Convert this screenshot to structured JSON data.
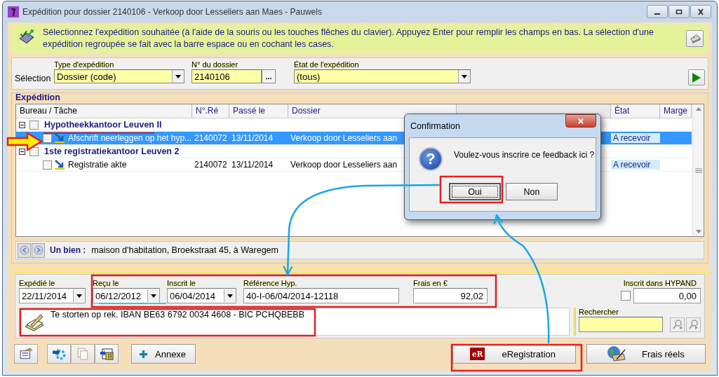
{
  "window": {
    "title": "Expédition pour dossier 2140106 - Verkoop door Lesseliers aan Maes - Pauwels"
  },
  "info": {
    "text": "Sélectionnez l'expédition souhaitée (à l'aide de la souris ou les touches flêches du clavier). Appuyez Enter pour remplir les champs en bas. La sélection d'une expédition regroupée se fait avec la barre espace ou en cochant les cases."
  },
  "selection": {
    "label": "Sélection",
    "fields": [
      {
        "kind": "dropdown",
        "label": "Type d'expédition",
        "value": "Dossier (code)"
      },
      {
        "kind": "browse",
        "label": "N° du dossier",
        "value": "2140106",
        "button": "..."
      },
      {
        "kind": "dropdown",
        "label": "État de l'expédition",
        "value": "(tous)"
      }
    ]
  },
  "expedition": {
    "title": "Expédition",
    "columns": [
      {
        "label": "Bureau / Tâche"
      },
      {
        "label": "N°.Ré"
      },
      {
        "label": "Passé le"
      },
      {
        "label": "Dossier"
      },
      {
        "label": "État"
      },
      {
        "label": "Marge"
      }
    ],
    "groups": [
      {
        "name": "Hypotheekkantoor Leuven II",
        "expanded": true,
        "checked": false,
        "children": [
          {
            "task": "Afschrift neerleggen op het hyp...",
            "ref": "2140072",
            "date": "13/11/2014",
            "dossier": "Verkoop door Lesseliers aan",
            "state": "A recevoir",
            "checked": false,
            "selected": true
          }
        ]
      },
      {
        "name": "1ste registratiekantoor Leuven 2",
        "expanded": true,
        "checked": false,
        "children": [
          {
            "task": "Registratie akte",
            "ref": "2140072",
            "date": "13/11/2014",
            "dossier": "Verkoop door Lesseliers aan",
            "state": "A recevoir",
            "checked": false,
            "selected": false
          }
        ]
      }
    ],
    "property": {
      "label": "Un bien :",
      "value": "maison d'habitation, Broekstraat 45, à Waregem"
    }
  },
  "form": {
    "fields": [
      {
        "kind": "date",
        "label": "Expédié le",
        "value": "22/11/2014"
      },
      {
        "kind": "date",
        "label": "Reçu le",
        "value": "06/12/2012"
      },
      {
        "kind": "date",
        "label": "Inscrit le",
        "value": "06/04/2014"
      },
      {
        "kind": "text",
        "label": "Référence Hyp.",
        "value": "40-I-06/04/2014-12118"
      },
      {
        "kind": "amount",
        "label": "Frais en €",
        "value": "92,02"
      }
    ],
    "hypand": {
      "label": "Inscrit dans HYPAND",
      "checked": false,
      "value": "0,00"
    },
    "note": "Te storten op rek. IBAN BE63 6792 0034 4608 - BIC PCHQBEBB",
    "search": {
      "label": "Rechercher"
    }
  },
  "buttons": {
    "annexe": "Annexe",
    "eregistration": {
      "badge": "eR",
      "label": "eRegistration"
    },
    "frais": "Frais réels"
  },
  "dialog": {
    "title": "Confirmation",
    "icon": "?",
    "message": "Voulez-vous inscrire ce feedback ici ?",
    "buttons": [
      {
        "label": "Oui",
        "selected": true
      },
      {
        "label": "Non",
        "selected": false
      }
    ]
  }
}
